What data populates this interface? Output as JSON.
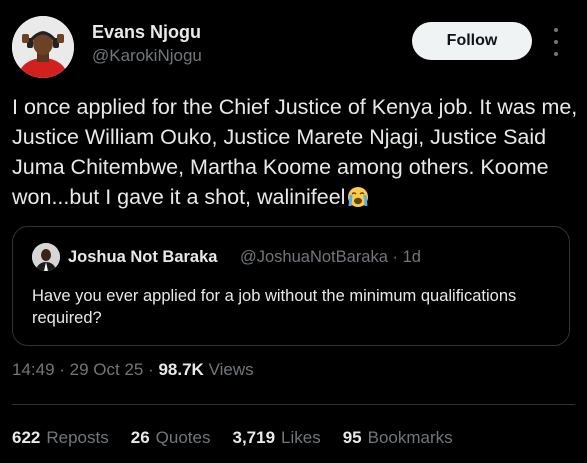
{
  "author": {
    "name": "Evans Njogu",
    "handle": "@KarokiNjogu",
    "follow_label": "Follow"
  },
  "tweet": {
    "text": "I once applied for the Chief Justice of Kenya job. It was me, Justice William Ouko, Justice Marete Njagi, Justice Said Juma Chitembwe, Martha Koome among others. Koome won...but I gave it a shot, walinifeel",
    "emoji": "loudly-crying-face-icon"
  },
  "quoted": {
    "name": "Joshua Not Baraka",
    "handle": "@JoshuaNotBaraka · 1d",
    "text": "Have you ever applied for a job without the minimum qualifications required?"
  },
  "meta": {
    "time_date": "14:49 · 29 Oct 25 · ",
    "views_count": "98.7K",
    "views_label": " Views"
  },
  "stats": {
    "reposts_count": "622",
    "reposts_label": "Reposts",
    "quotes_count": "26",
    "quotes_label": "Quotes",
    "likes_count": "3,719",
    "likes_label": "Likes",
    "bookmarks_count": "95",
    "bookmarks_label": "Bookmarks"
  },
  "colors": {
    "background": "#000000",
    "text_primary": "#e7e9ea",
    "text_secondary": "#71767b",
    "border": "#2f3336",
    "follow_bg": "#eff3f4"
  }
}
